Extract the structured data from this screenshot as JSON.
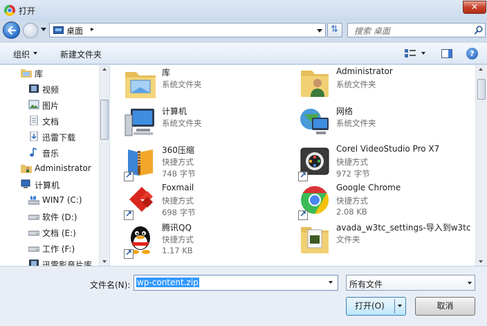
{
  "window": {
    "title": "打开",
    "close": "✕"
  },
  "address": {
    "location": "桌面",
    "separator": "▸",
    "search_placeholder": "搜索 桌面"
  },
  "toolbar": {
    "organize": "组织",
    "new_folder": "新建文件夹",
    "help": "?"
  },
  "nav": {
    "items": [
      {
        "label": "库",
        "icon": "library-folder-icon"
      },
      {
        "label": "视频",
        "icon": "video-library-icon"
      },
      {
        "label": "图片",
        "icon": "picture-library-icon"
      },
      {
        "label": "文档",
        "icon": "document-library-icon"
      },
      {
        "label": "迅雷下载",
        "icon": "download-folder-icon"
      },
      {
        "label": "音乐",
        "icon": "music-library-icon"
      },
      {
        "label": "Administrator",
        "icon": "user-folder-icon"
      },
      {
        "label": "计算机",
        "icon": "computer-icon"
      },
      {
        "label": "WIN7 (C:)",
        "icon": "system-drive-icon"
      },
      {
        "label": "软件 (D:)",
        "icon": "drive-icon"
      },
      {
        "label": "文档 (E:)",
        "icon": "drive-icon"
      },
      {
        "label": "工作 (F:)",
        "icon": "drive-icon"
      },
      {
        "label": "迅雷影音片库",
        "icon": "video-folder-icon"
      }
    ]
  },
  "files": [
    {
      "name": "库",
      "type": "系统文件夹",
      "size": ""
    },
    {
      "name": "Administrator",
      "type": "系统文件夹",
      "size": ""
    },
    {
      "name": "计算机",
      "type": "系统文件夹",
      "size": ""
    },
    {
      "name": "网络",
      "type": "系统文件夹",
      "size": ""
    },
    {
      "name": "360压缩",
      "type": "快捷方式",
      "size": "748 字节"
    },
    {
      "name": "Corel VideoStudio Pro X7",
      "type": "快捷方式",
      "size": "972 字节"
    },
    {
      "name": "Foxmail",
      "type": "快捷方式",
      "size": "698 字节"
    },
    {
      "name": "Google Chrome",
      "type": "快捷方式",
      "size": "2.08 KB"
    },
    {
      "name": "腾讯QQ",
      "type": "快捷方式",
      "size": "1.17 KB"
    },
    {
      "name": "avada_w3tc_settings-导入到w3tc",
      "type": "文件夹",
      "size": ""
    }
  ],
  "bottom": {
    "filename_label": "文件名(N):",
    "filename_value": "wp-content.zip",
    "filetype_value": "所有文件",
    "open_label": "打开(O)",
    "cancel_label": "取消"
  }
}
